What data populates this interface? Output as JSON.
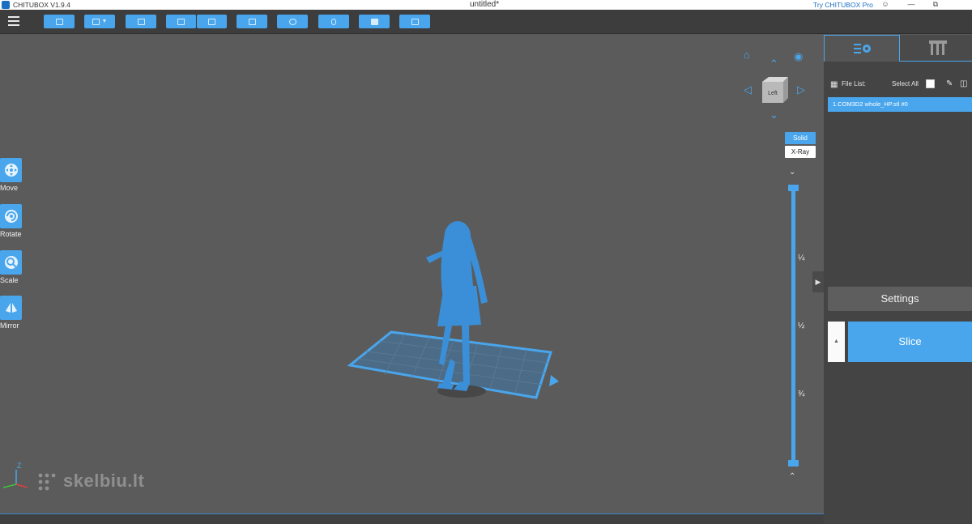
{
  "titlebar": {
    "app_title": "CHITUBOX V1.9.4",
    "document_title": "untitled*",
    "pro_link": "Try CHITUBOX Pro",
    "user_icon": "user-icon",
    "minimize_icon": "minimize-icon",
    "restore_icon": "restore-icon"
  },
  "toolbar": {
    "menu_icon": "hamburger-menu-icon",
    "buttons": [
      "open-file",
      "save-dropdown",
      "layout",
      "import",
      "export",
      "duplicate",
      "supports",
      "hollow",
      "dig-hole",
      "add-feature"
    ]
  },
  "left_tools": [
    {
      "label": "Move",
      "icon": "move-icon"
    },
    {
      "label": "Rotate",
      "icon": "rotate-icon"
    },
    {
      "label": "Scale",
      "icon": "scale-icon"
    },
    {
      "label": "Mirror",
      "icon": "mirror-icon"
    }
  ],
  "view_cube": {
    "face_label": "Left",
    "home_icon": "home-icon",
    "eye_icon": "eye-icon"
  },
  "render_modes": {
    "solid": "Solid",
    "xray": "X-Ray",
    "active": "Solid"
  },
  "layer_slider": {
    "marks": [
      "¼",
      "½",
      "¾"
    ]
  },
  "watermark": "skelbiu.lt",
  "axes": {
    "z": "Z"
  },
  "right_panel": {
    "file_list_label": "File List:",
    "select_all_label": "Select All",
    "files": [
      "1.COM3D2 whole_HP.stl #0"
    ],
    "settings_label": "Settings",
    "slice_label": "Slice",
    "slice_side_icon": "triangle-up-icon"
  },
  "colors": {
    "accent": "#4aa6ec",
    "viewport_bg": "#5b5b5b",
    "panel_bg": "#444444"
  }
}
